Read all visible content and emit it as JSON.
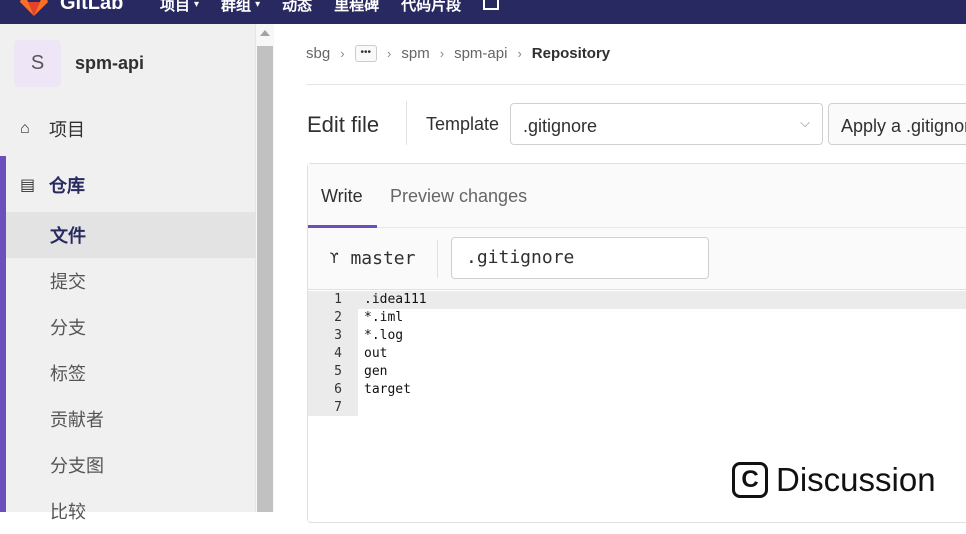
{
  "topbar": {
    "logo_text": "GitLab",
    "nav": [
      {
        "label": "项目",
        "has_dropdown": true
      },
      {
        "label": "群组",
        "has_dropdown": true
      },
      {
        "label": "动态",
        "has_dropdown": false
      },
      {
        "label": "里程碑",
        "has_dropdown": false
      },
      {
        "label": "代码片段",
        "has_dropdown": false
      }
    ],
    "bg_color": "#292961"
  },
  "sidebar": {
    "project_initial": "S",
    "project_name": "spm-api",
    "items": [
      {
        "label": "项目",
        "icon": "home-icon"
      },
      {
        "label": "仓库",
        "icon": "document-icon",
        "active": true
      }
    ],
    "sub_items": [
      {
        "label": "文件",
        "active": true
      },
      {
        "label": "提交"
      },
      {
        "label": "分支"
      },
      {
        "label": "标签"
      },
      {
        "label": "贡献者"
      },
      {
        "label": "分支图"
      },
      {
        "label": "比较"
      }
    ],
    "accent_color": "#6b4fbb"
  },
  "breadcrumb": {
    "items": [
      "sbg",
      "spm",
      "spm-api"
    ],
    "more": "•••",
    "current": "Repository"
  },
  "editor_header": {
    "title": "Edit file",
    "template_label": "Template",
    "template_value": ".gitignore",
    "apply_label": "Apply a .gitignore"
  },
  "editor": {
    "tabs": [
      {
        "label": "Write",
        "active": true
      },
      {
        "label": "Preview changes",
        "active": false
      }
    ],
    "branch": "master",
    "filename": ".gitignore",
    "lines": [
      {
        "n": "1",
        "text": ".idea111"
      },
      {
        "n": "2",
        "text": "*.iml"
      },
      {
        "n": "3",
        "text": "*.log"
      },
      {
        "n": "4",
        "text": "out"
      },
      {
        "n": "5",
        "text": "gen"
      },
      {
        "n": "6",
        "text": "target"
      },
      {
        "n": "7",
        "text": ""
      }
    ]
  },
  "watermark": {
    "glyph": "C",
    "text": "Discussion"
  }
}
